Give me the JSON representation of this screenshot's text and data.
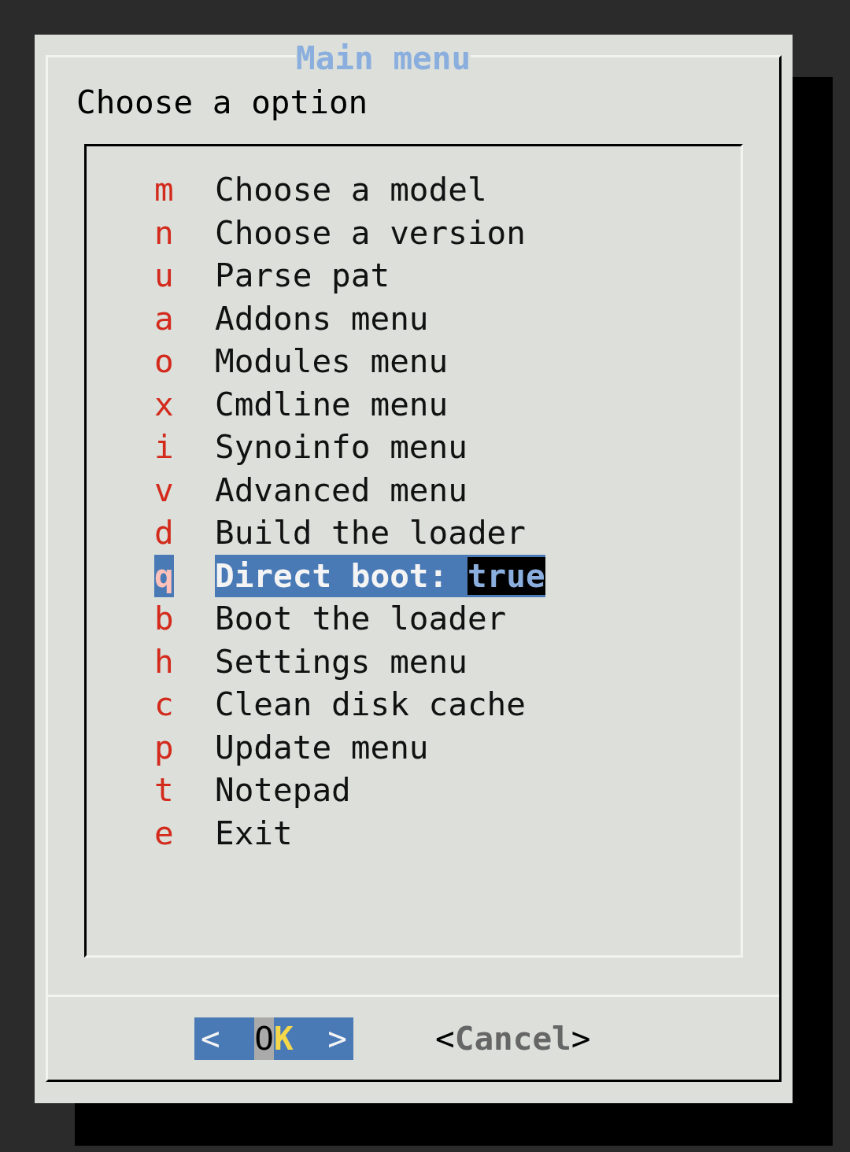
{
  "dialog": {
    "title": "Main menu",
    "prompt": "Choose a option"
  },
  "menu": [
    {
      "key": "m",
      "label": "Choose a model",
      "selected": false
    },
    {
      "key": "n",
      "label": "Choose a version",
      "selected": false
    },
    {
      "key": "u",
      "label": "Parse pat",
      "selected": false
    },
    {
      "key": "a",
      "label": "Addons menu",
      "selected": false
    },
    {
      "key": "o",
      "label": "Modules menu",
      "selected": false
    },
    {
      "key": "x",
      "label": "Cmdline menu",
      "selected": false
    },
    {
      "key": "i",
      "label": "Synoinfo menu",
      "selected": false
    },
    {
      "key": "v",
      "label": "Advanced menu",
      "selected": false
    },
    {
      "key": "d",
      "label": "Build the loader",
      "selected": false
    },
    {
      "key": "q",
      "label": "Direct boot: ",
      "value": "true",
      "selected": true
    },
    {
      "key": "b",
      "label": "Boot the loader",
      "selected": false
    },
    {
      "key": "h",
      "label": "Settings menu",
      "selected": false
    },
    {
      "key": "c",
      "label": "Clean disk cache",
      "selected": false
    },
    {
      "key": "p",
      "label": "Update menu",
      "selected": false
    },
    {
      "key": "t",
      "label": "Notepad",
      "selected": false
    },
    {
      "key": "e",
      "label": "Exit",
      "selected": false
    }
  ],
  "buttons": [
    {
      "open": "<",
      "label": "OK",
      "close": ">",
      "selected": true
    },
    {
      "open": "<",
      "label": "Cancel",
      "close": ">",
      "selected": false
    }
  ]
}
